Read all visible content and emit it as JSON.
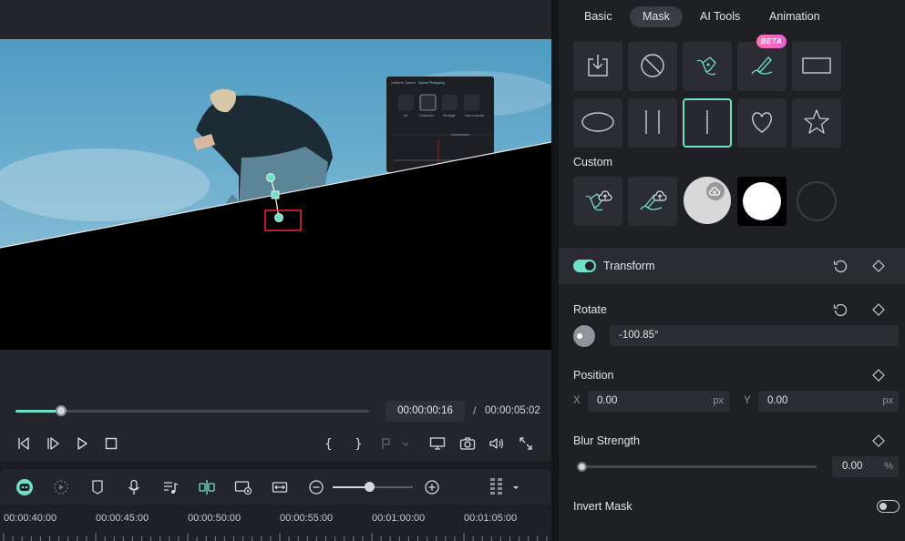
{
  "playback": {
    "current_time": "00:00:00:16",
    "separator": "/",
    "total_time": "00:00:05:02",
    "progress": 0.13
  },
  "overlay_panel": {
    "tab_left": "Uniform Speed",
    "tab_right": "Speed Ramping",
    "options": [
      "No",
      "Customize",
      "Montage",
      "Hero moment"
    ]
  },
  "timeline": {
    "ticks": [
      "00:00:40:00",
      "00:00:45:00",
      "00:00:50:00",
      "00:00:55:00",
      "00:01:00:00",
      "00:01:05:00"
    ],
    "zoom_level": 0.46
  },
  "tabs": [
    {
      "label": "Basic",
      "active": false
    },
    {
      "label": "Mask",
      "active": true
    },
    {
      "label": "AI Tools",
      "active": false
    },
    {
      "label": "Animation",
      "active": false
    }
  ],
  "mask": {
    "beta_label": "BETA",
    "presets": [
      "import-mask-icon",
      "no-mask-icon",
      "pen-mask-icon",
      "brush-mask-icon",
      "rectangle-mask-icon",
      "ellipse-mask-icon",
      "double-line-mask-icon",
      "single-line-mask-icon",
      "heart-mask-icon",
      "star-mask-icon"
    ],
    "custom_label": "Custom",
    "custom": [
      "custom-pen-upload-icon",
      "custom-brush-upload-icon",
      "custom-upload-icon",
      "custom-white-circle",
      "custom-empty-circle"
    ]
  },
  "transform": {
    "label": "Transform",
    "enabled": true
  },
  "rotate": {
    "label": "Rotate",
    "value": "-100.85°"
  },
  "position": {
    "label": "Position",
    "x_label": "X",
    "x_value": "0.00",
    "x_unit": "px",
    "y_label": "Y",
    "y_value": "0.00",
    "y_unit": "px"
  },
  "blur": {
    "label": "Blur Strength",
    "value": "0.00",
    "unit": "%",
    "level": 0
  },
  "invert": {
    "label": "Invert Mask",
    "enabled": false
  },
  "colors": {
    "accent": "#6fe0c8",
    "highlight_box": "#e0282c"
  }
}
